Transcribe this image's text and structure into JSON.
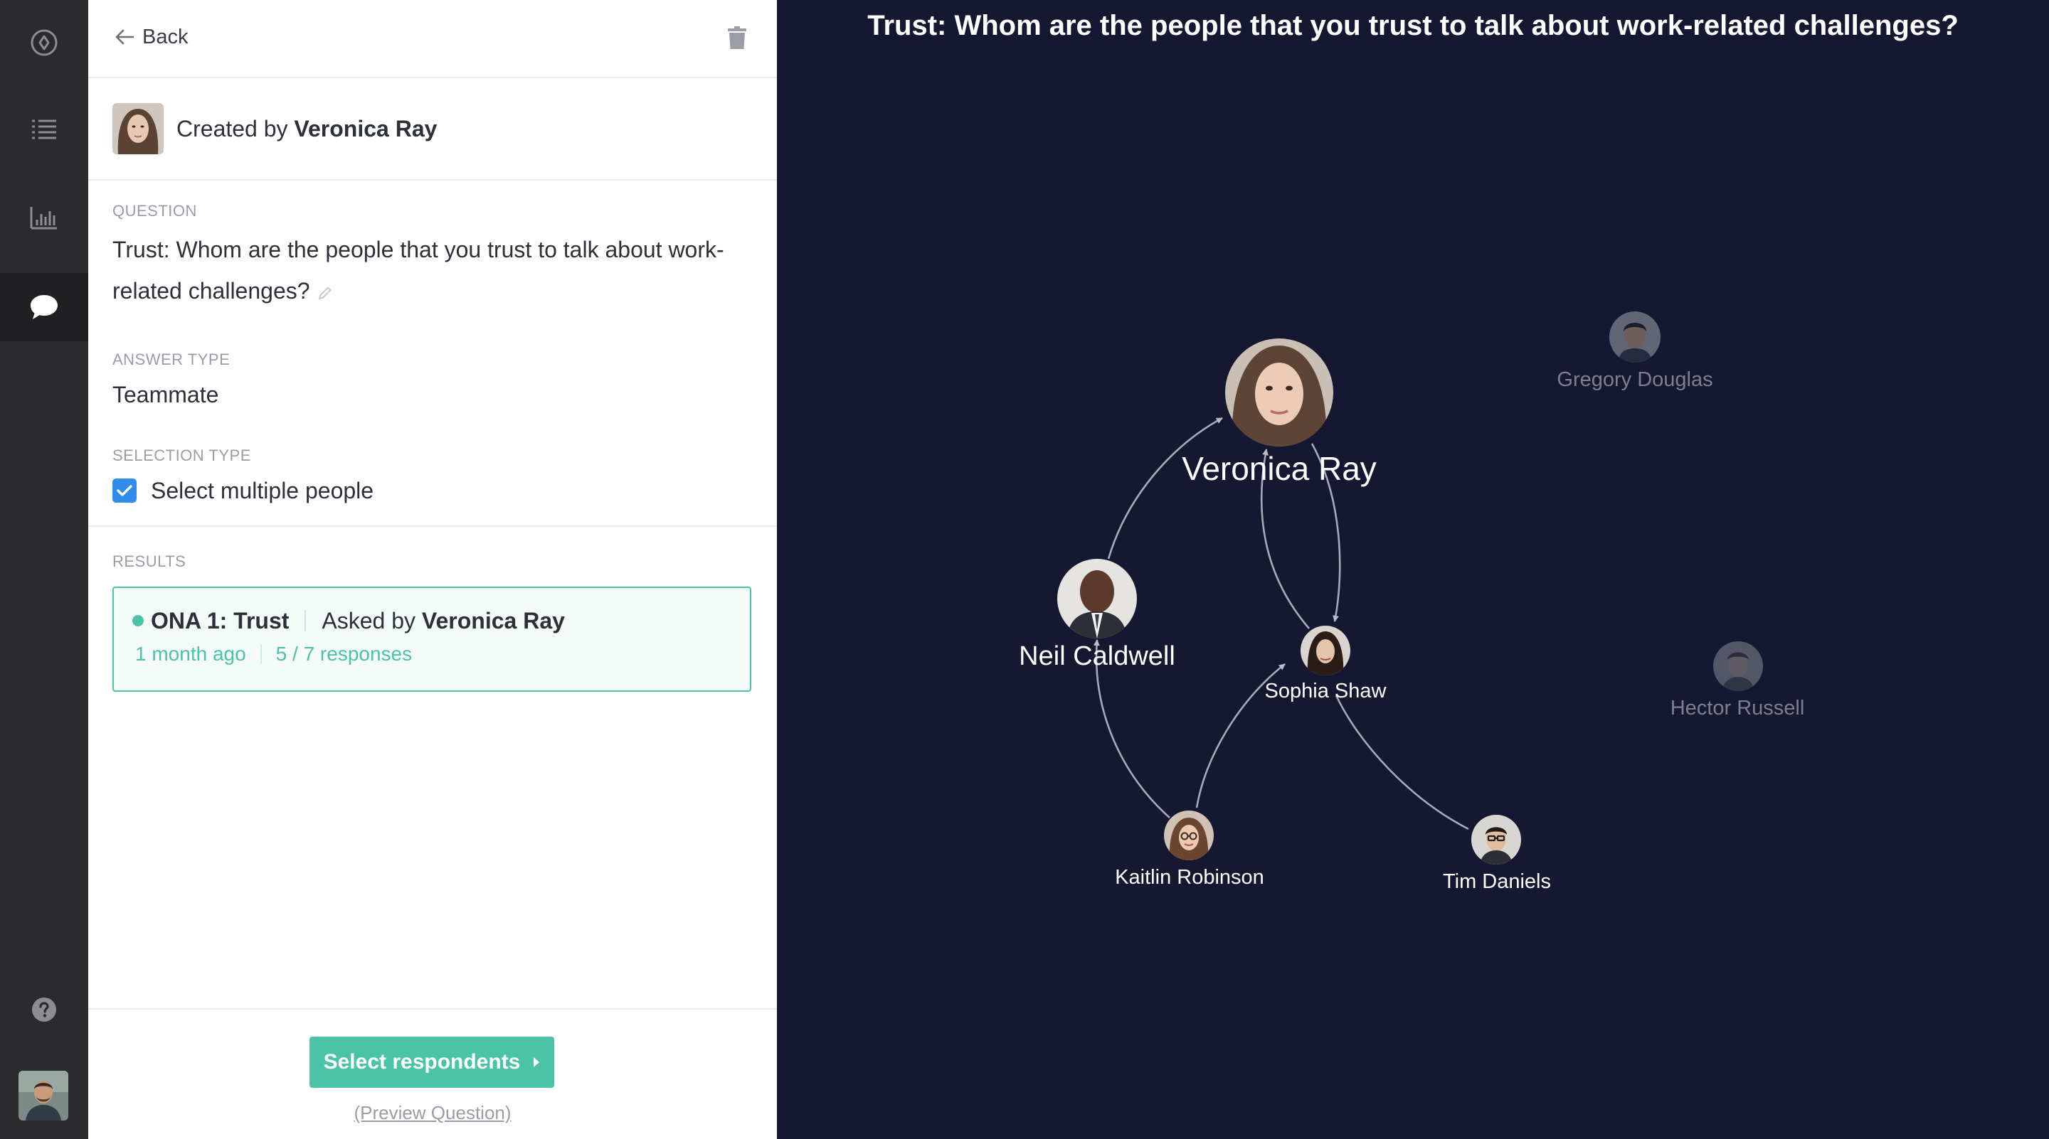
{
  "sidebar": {
    "icons": [
      "compass-icon",
      "list-icon",
      "bar-chart-icon",
      "chat-bubble-icon",
      "help-icon"
    ],
    "active": "chat-bubble-icon"
  },
  "panel": {
    "back_label": "Back",
    "created_by_prefix": "Created by",
    "creator_name": "Veronica Ray",
    "question_label": "QUESTION",
    "question_text": "Trust: Whom are the people that you trust to talk about work-related challenges?",
    "answer_type_label": "ANSWER TYPE",
    "answer_type_value": "Teammate",
    "selection_type_label": "SELECTION TYPE",
    "selection_checkbox_label": "Select multiple people",
    "selection_checked": true,
    "results_label": "RESULTS",
    "result": {
      "title": "ONA 1: Trust",
      "asked_by_prefix": "Asked by",
      "asked_by_name": "Veronica Ray",
      "age": "1 month ago",
      "responses": "5 / 7 responses"
    },
    "select_respondents_label": "Select respondents",
    "preview_link_label": "(Preview Question)"
  },
  "graph": {
    "title": "Trust: Whom are the people that you trust to talk about work-related challenges?",
    "nodes": [
      {
        "name": "Veronica Ray",
        "dimmed": false
      },
      {
        "name": "Neil Caldwell",
        "dimmed": false
      },
      {
        "name": "Sophia Shaw",
        "dimmed": false
      },
      {
        "name": "Kaitlin Robinson",
        "dimmed": false
      },
      {
        "name": "Tim Daniels",
        "dimmed": false
      },
      {
        "name": "Gregory Douglas",
        "dimmed": true
      },
      {
        "name": "Hector Russell",
        "dimmed": true
      }
    ],
    "edges": [
      {
        "from": "Neil Caldwell",
        "to": "Veronica Ray"
      },
      {
        "from": "Sophia Shaw",
        "to": "Veronica Ray"
      },
      {
        "from": "Veronica Ray",
        "to": "Sophia Shaw"
      },
      {
        "from": "Kaitlin Robinson",
        "to": "Neil Caldwell"
      },
      {
        "from": "Kaitlin Robinson",
        "to": "Sophia Shaw"
      },
      {
        "from": "Tim Daniels",
        "to": "Sophia Shaw"
      }
    ]
  },
  "colors": {
    "accent": "#4bc3a6",
    "checkbox": "#2f8cea",
    "graph_bg": "#161832",
    "rail_bg": "#2b2b2e"
  }
}
